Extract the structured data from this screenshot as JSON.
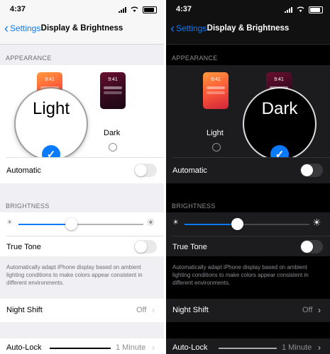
{
  "light": {
    "status": {
      "time": "4:37"
    },
    "nav": {
      "back": "Settings",
      "title": "Display & Brightness"
    },
    "appearance": {
      "header": "APPEARANCE",
      "phone_time": "9:41",
      "options": [
        {
          "label": "Light",
          "selected": true
        },
        {
          "label": "Dark",
          "selected": false
        }
      ],
      "magnified_label": "Light"
    },
    "automatic": {
      "label": "Automatic",
      "on": false
    },
    "brightness": {
      "header": "BRIGHTNESS",
      "level": 0.42
    },
    "true_tone": {
      "label": "True Tone",
      "on": false,
      "description": "Automatically adapt iPhone display based on ambient lighting conditions to make colors appear consistent in different environments."
    },
    "night_shift": {
      "label": "Night Shift",
      "value": "Off"
    },
    "auto_lock": {
      "label": "Auto-Lock",
      "value": "1 Minute"
    }
  },
  "dark": {
    "status": {
      "time": "4:37"
    },
    "nav": {
      "back": "Settings",
      "title": "Display & Brightness"
    },
    "appearance": {
      "header": "APPEARANCE",
      "phone_time": "9:41",
      "options": [
        {
          "label": "Light",
          "selected": false
        },
        {
          "label": "Dark",
          "selected": true
        }
      ],
      "magnified_label": "Dark"
    },
    "automatic": {
      "label": "Automatic",
      "on": false
    },
    "brightness": {
      "header": "BRIGHTNESS",
      "level": 0.42
    },
    "true_tone": {
      "label": "True Tone",
      "on": false,
      "description": "Automatically adapt iPhone display based on ambient lighting conditions to make colors appear consistent in different environments."
    },
    "night_shift": {
      "label": "Night Shift",
      "value": "Off"
    },
    "auto_lock": {
      "label": "Auto-Lock",
      "value": "1 Minute"
    }
  },
  "colors": {
    "accent": "#0a7aff"
  },
  "icons": {
    "back": "chevron-left-icon",
    "check": "checkmark-icon",
    "sun_small": "sun-small-icon",
    "sun_large": "sun-large-icon"
  }
}
